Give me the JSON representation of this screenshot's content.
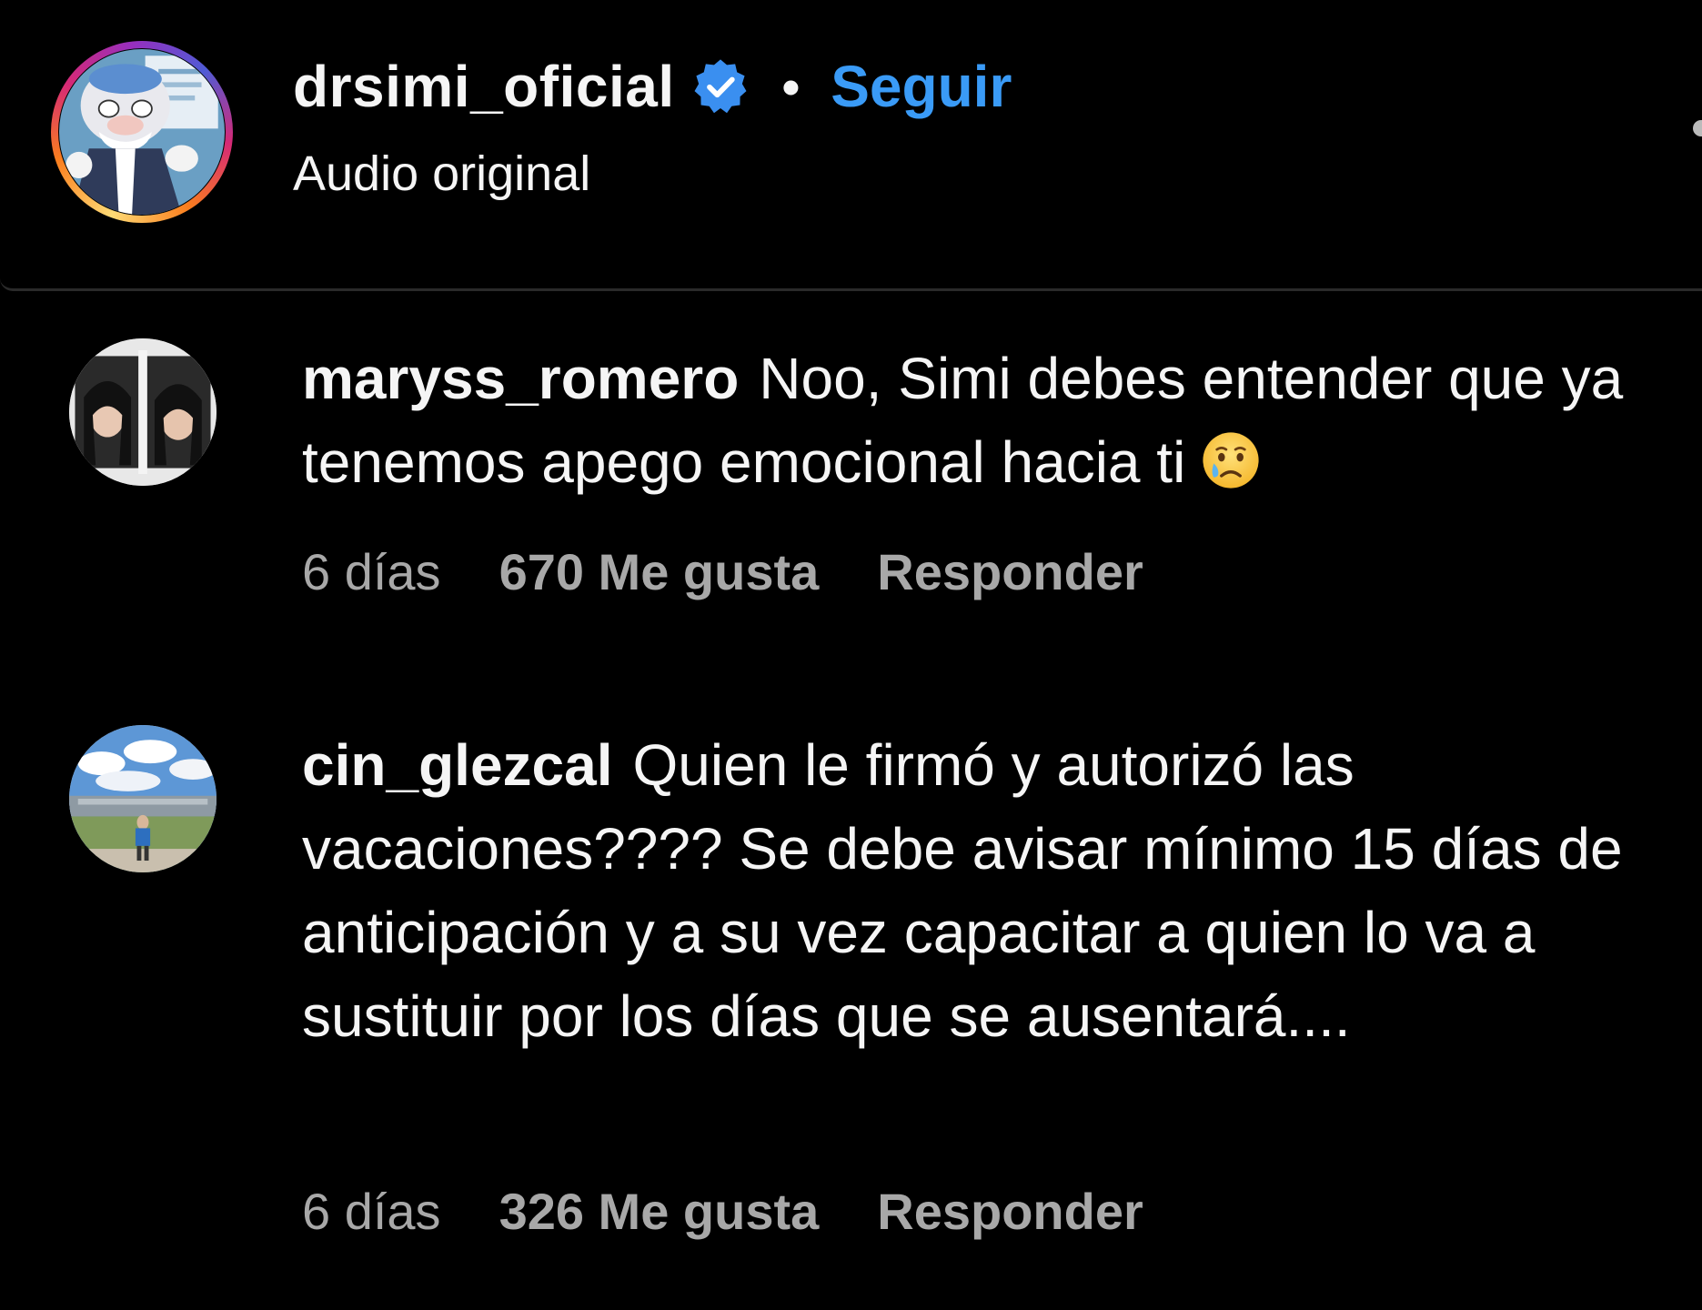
{
  "header": {
    "username": "drsimi_oficial",
    "separator": "•",
    "follow_label": "Seguir",
    "audio_label": "Audio original"
  },
  "comments": [
    {
      "username": "maryss_romero",
      "text": "Noo, Simi debes entender que ya tenemos apego emocional hacia ti",
      "emoji": "crying-face",
      "time": "6 días",
      "likes": "670 Me gusta",
      "reply_label": "Responder"
    },
    {
      "username": "cin_glezcal",
      "text": "Quien le firmó y autorizó las vacaciones???? Se debe avisar mínimo 15 días de anticipación y a su vez capacitar a quien lo va a sustituir por los días que se ausentará....",
      "time": "6 días",
      "likes": "326 Me gusta",
      "reply_label": "Responder"
    }
  ],
  "colors": {
    "background": "#000000",
    "text": "#f5f5f5",
    "muted": "#a8a8a8",
    "accent": "#3a9bf7",
    "verified": "#3a8ff0"
  }
}
